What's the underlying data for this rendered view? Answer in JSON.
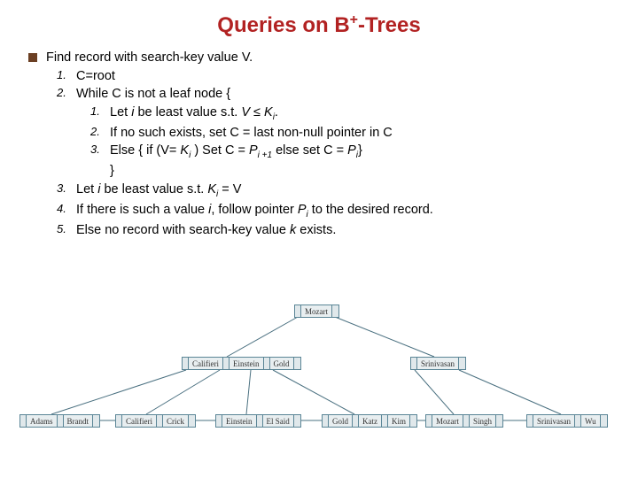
{
  "title_prefix": "Queries on B",
  "title_sup": "+",
  "title_suffix": "-Trees",
  "intro": "Find record with search-key value V.",
  "step1": "C=root",
  "step2": "While C is not a leaf node {",
  "sub1_a": "Let ",
  "sub1_b": " be least value s.t. ",
  "sub1_c": "V ≤ K",
  "sub1_d": "i",
  "sub1_e": ".",
  "sub2": "If no such exists, set C = last non-null pointer in C",
  "sub3_a": "Else { if (V= ",
  "sub3_b": "K",
  "sub3_c": "i",
  "sub3_d": " ) Set C = ",
  "sub3_e": "P",
  "sub3_f": "i +1",
  "sub3_g": " else set C = ",
  "sub3_h": "P",
  "sub3_i": "i",
  "sub3_j": "}",
  "closebrace": "}",
  "step3_a": "Let ",
  "step3_b": " be least value s.t. ",
  "step3_c": "K",
  "step3_d": "i",
  "step3_e": " = V",
  "step4_a": "If there is such a value ",
  "step4_b": ",  follow pointer ",
  "step4_c": "P",
  "step4_d": "i",
  "step4_e": "  to the desired record.",
  "step5_a": "Else no record with search-key value ",
  "step5_b": " exists.",
  "i": "i",
  "k": "k",
  "n1": "1.",
  "n2": "2.",
  "n3": "3.",
  "n4": "4.",
  "n5": "5.",
  "tree": {
    "root": [
      "Mozart"
    ],
    "internal": [
      [
        "Califieri",
        "Einstein",
        "Gold"
      ],
      [
        "Srinivasan"
      ]
    ],
    "leaves": [
      [
        "Adams",
        "Brandt"
      ],
      [
        "Califieri",
        "Crick"
      ],
      [
        "Einstein",
        "El Said"
      ],
      [
        "Gold",
        "Katz",
        "Kim"
      ],
      [
        "Mozart",
        "Singh"
      ],
      [
        "Srinivasan",
        "Wu"
      ]
    ]
  }
}
